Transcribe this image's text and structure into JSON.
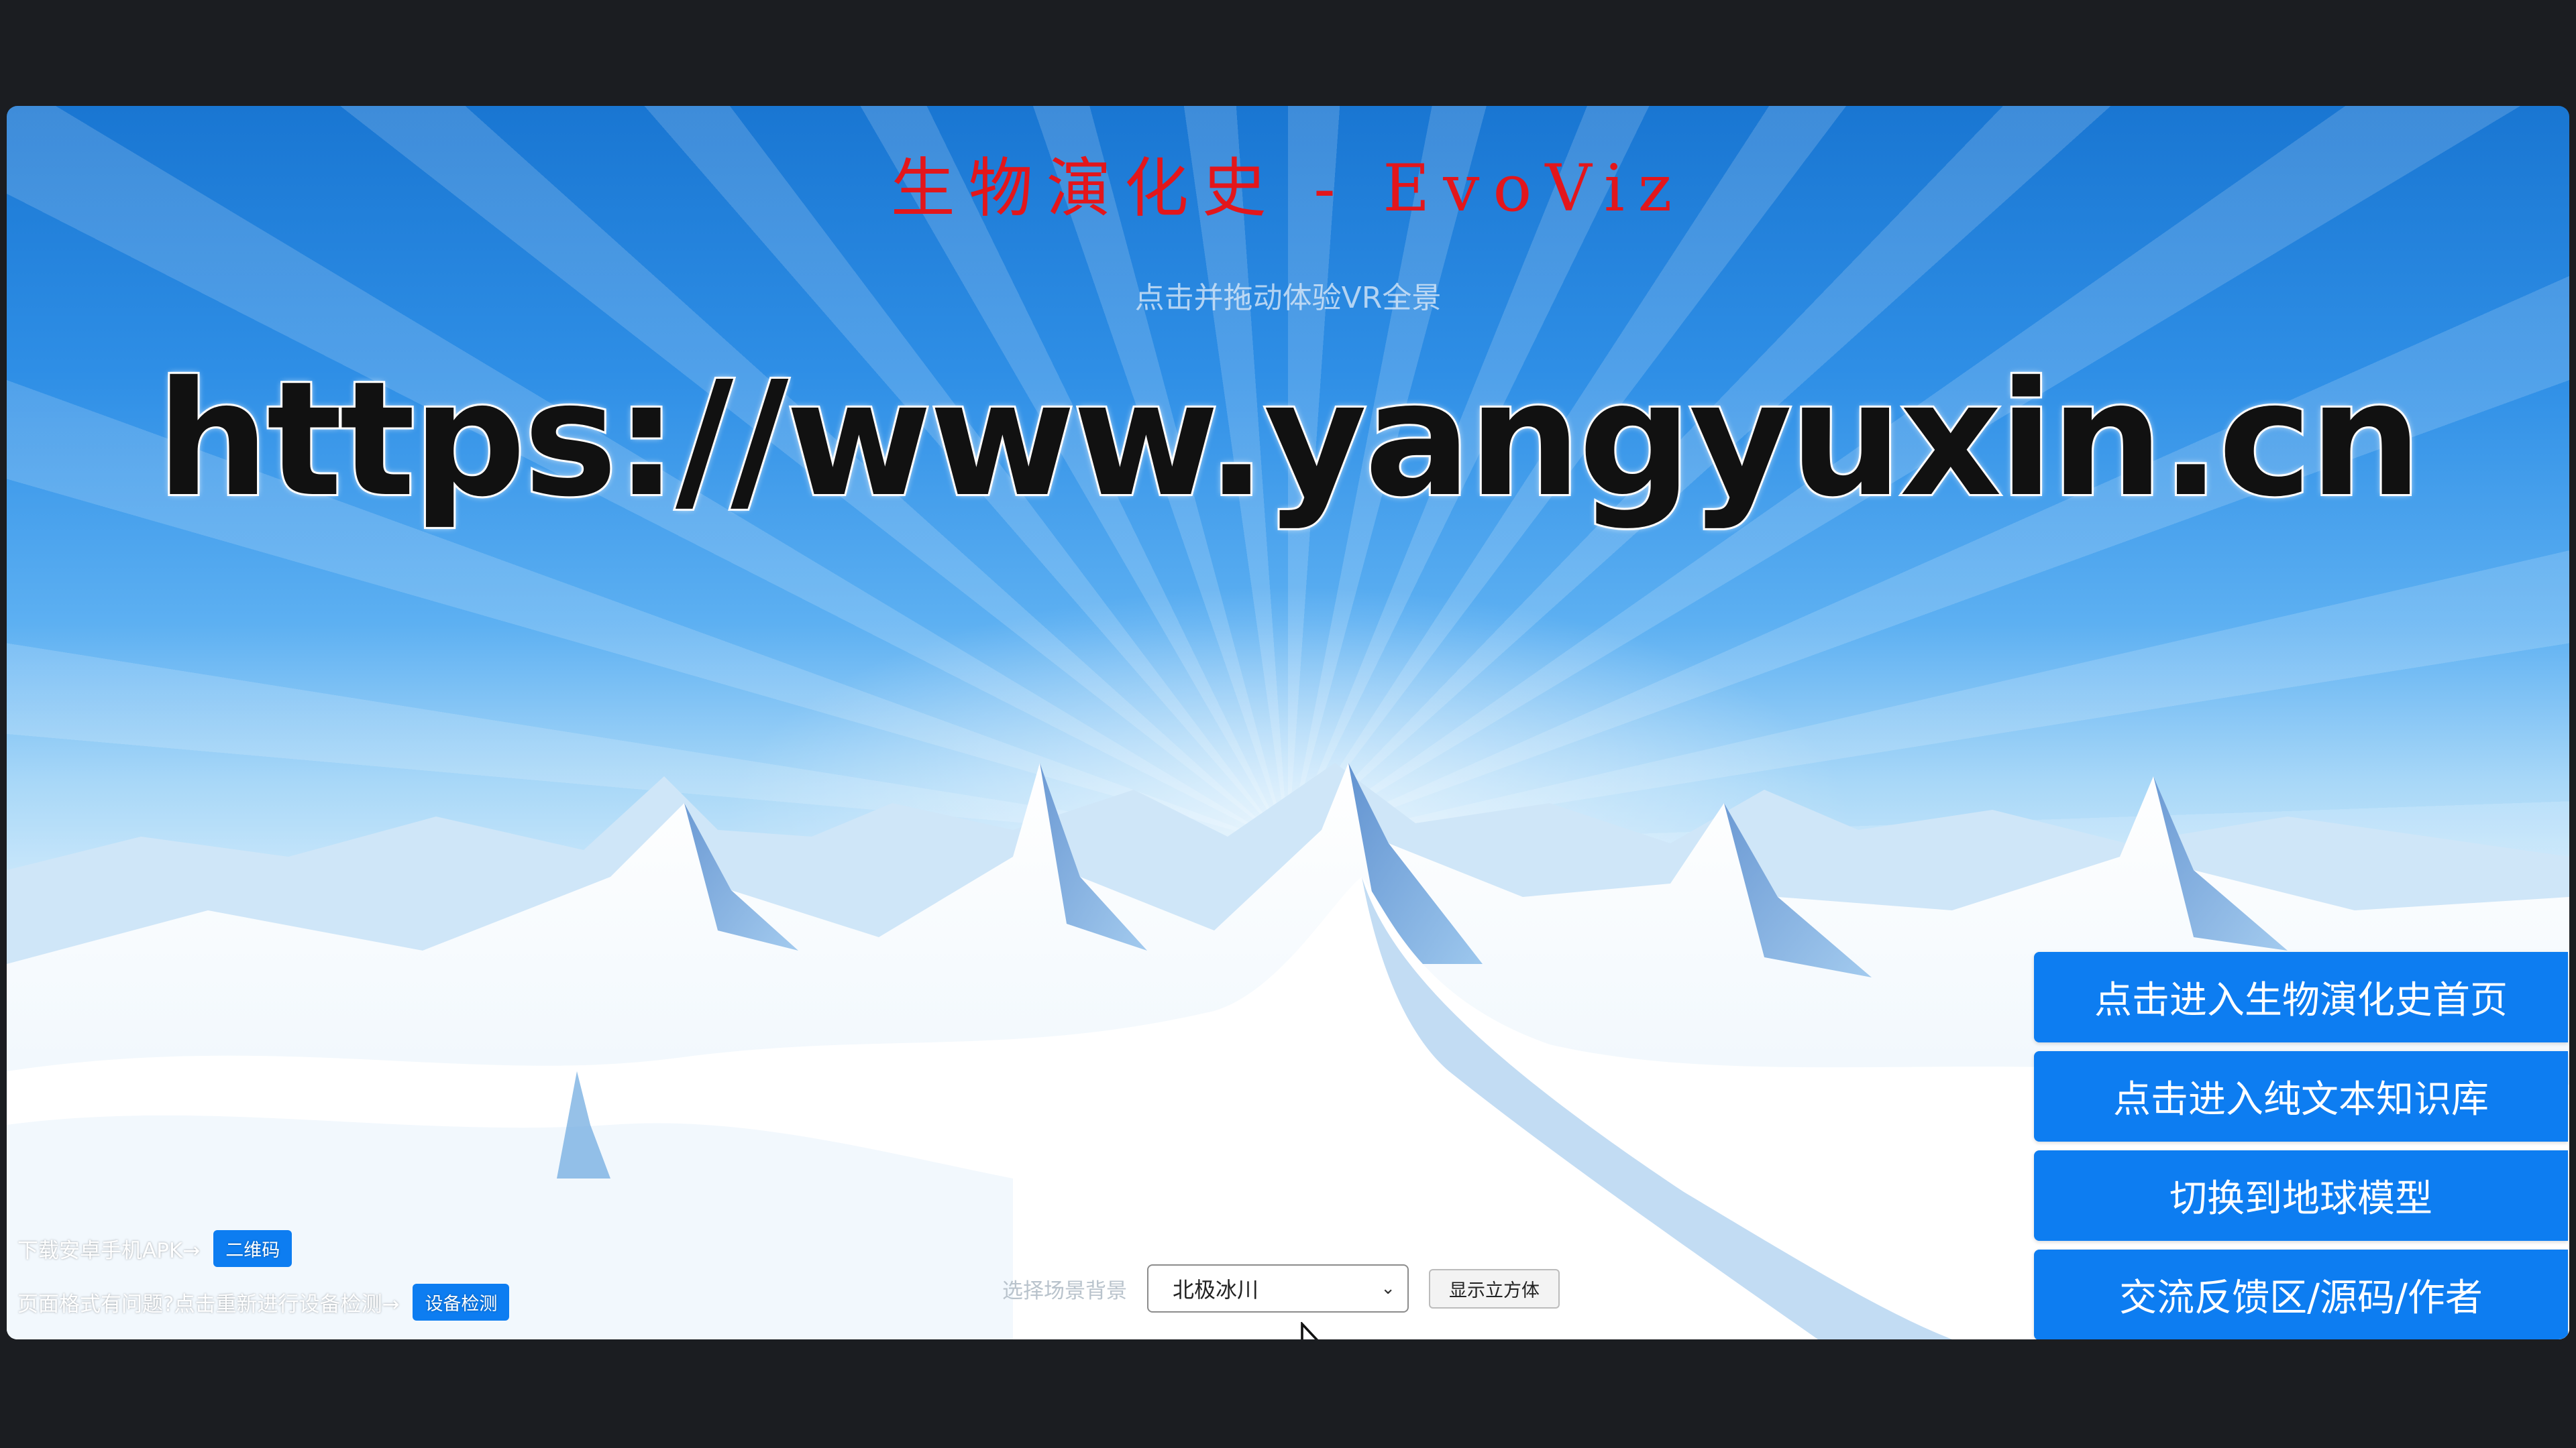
{
  "app": {
    "title": "生物演化史 - EvoViz",
    "subtitle": "点击并拖动体验VR全景",
    "watermark_url": "https://www.yangyuxin.cn"
  },
  "side_menu": [
    {
      "label": "点击进入生物演化史首页"
    },
    {
      "label": "点击进入纯文本知识库"
    },
    {
      "label": "切换到地球模型"
    },
    {
      "label": "交流反馈区/源码/作者"
    }
  ],
  "bottom_left": {
    "apk_text": "下载安卓手机APK→",
    "qr_button": "二维码",
    "format_text": "页面格式有问题?点击重新进行设备检测→",
    "detect_button": "设备检测"
  },
  "scene": {
    "label": "选择场景背景",
    "selected": "北极冰川",
    "cube_button": "显示立方体"
  },
  "colors": {
    "title_red": "#e3161b",
    "button_blue": "#0d7df1",
    "sky_blue": "#1976d2"
  }
}
